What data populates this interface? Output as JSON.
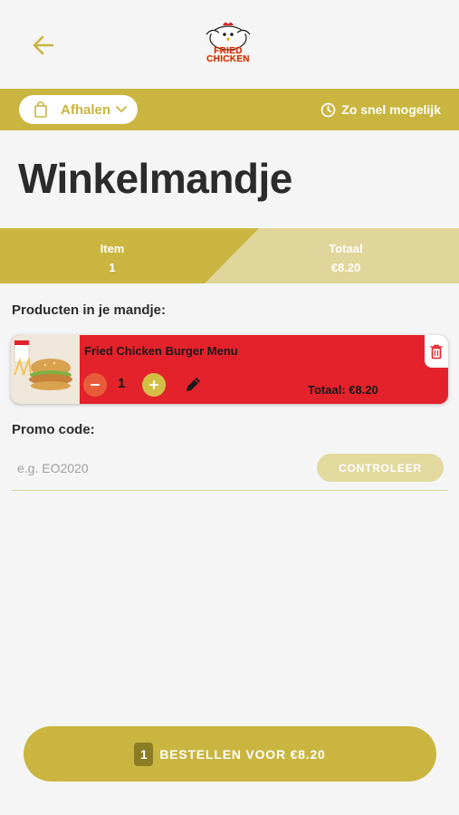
{
  "header": {
    "back_icon": "arrow-left-icon",
    "logo_text_line1": "FRIED",
    "logo_text_line2": "CHICKEN"
  },
  "mode_bar": {
    "pickup_label": "Afhalen",
    "pickup_icon": "shopping-bag-icon",
    "time_label": "Zo snel mogelijk",
    "time_icon": "clock-icon"
  },
  "page_title": "Winkelmandje",
  "summary": {
    "item_label": "Item",
    "item_value": "1",
    "total_label": "Totaal",
    "total_value": "€8.20"
  },
  "products_heading": "Producten in je mandje:",
  "cart_items": [
    {
      "name": "Fried Chicken Burger Menu",
      "quantity": "1",
      "total": "Totaal: €8.20"
    }
  ],
  "promo": {
    "label": "Promo code:",
    "placeholder": "e.g. EO2020",
    "value": "",
    "button_label": "CONTROLEER"
  },
  "order_button": {
    "count": "1",
    "label": "BESTELLEN VOOR €8.20"
  },
  "colors": {
    "brand_gold": "#c9b53f",
    "brand_gold_light": "#e0d59a",
    "card_red": "#e3222b",
    "background": "#f5f5f5"
  }
}
